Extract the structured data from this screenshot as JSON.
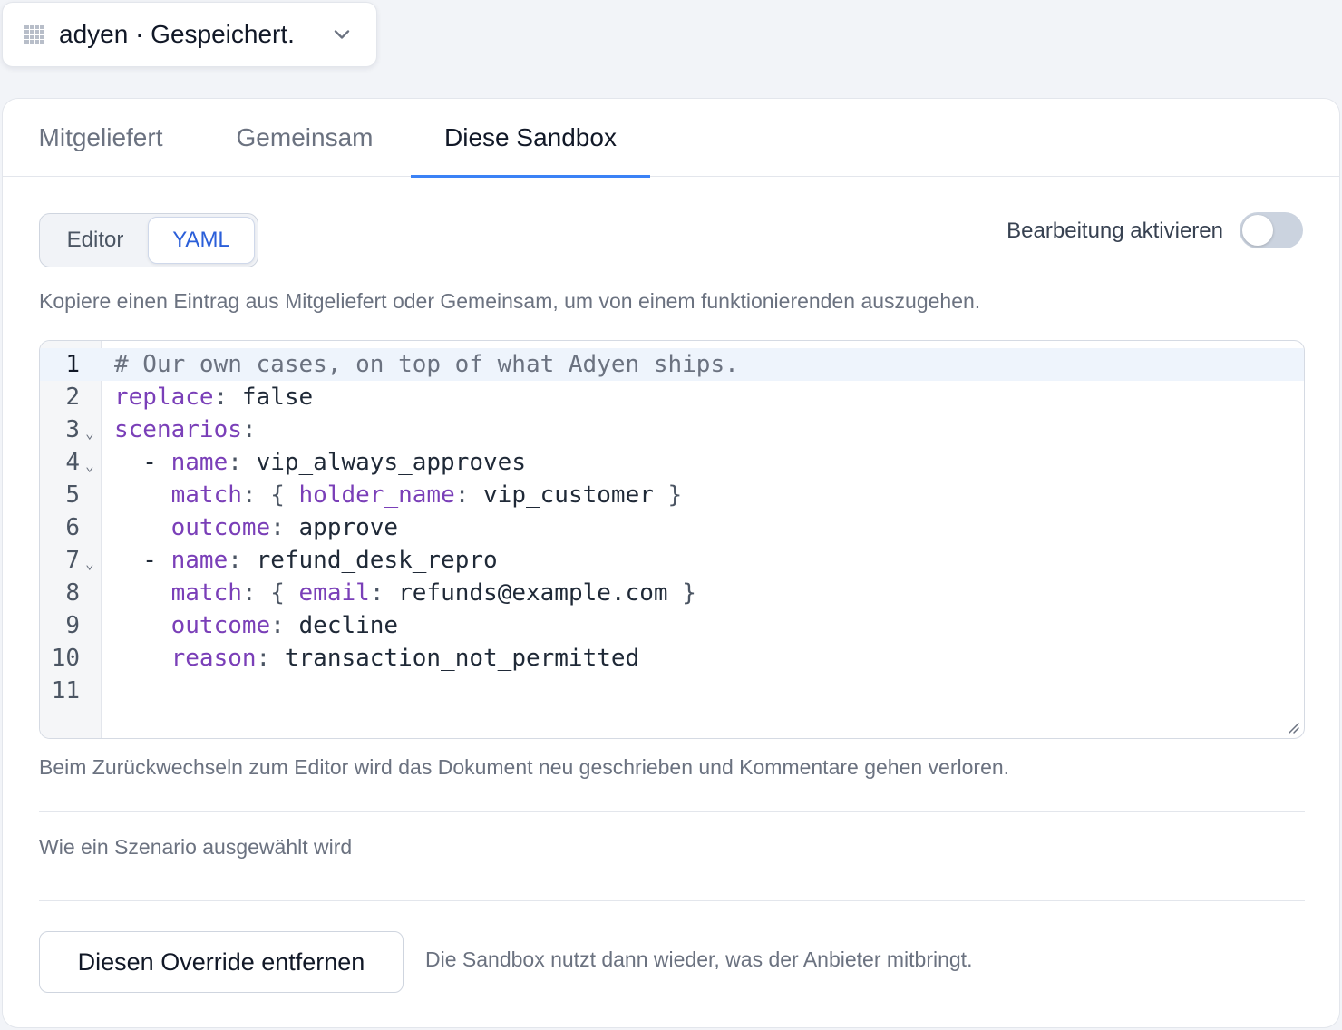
{
  "picker": {
    "label": "adyen · Gespeichert.",
    "icon": "grid-icon"
  },
  "tabs": [
    {
      "label": "Mitgeliefert",
      "active": false
    },
    {
      "label": "Gemeinsam",
      "active": false
    },
    {
      "label": "Diese Sandbox",
      "active": true
    }
  ],
  "mode_switch": {
    "editor_label": "Editor",
    "yaml_label": "YAML",
    "selected": "YAML"
  },
  "edit_toggle": {
    "label": "Bearbeitung aktivieren",
    "enabled": false
  },
  "hint_text": "Kopiere einen Eintrag aus Mitgeliefert oder Gemeinsam, um von einem funktionierenden auszugehen.",
  "code": {
    "lines": [
      {
        "n": "1",
        "fold": false,
        "tokens": [
          {
            "t": "c",
            "s": "# Our own cases, on top of what Adyen ships."
          }
        ]
      },
      {
        "n": "2",
        "fold": false,
        "tokens": [
          {
            "t": "k",
            "s": "replace"
          },
          {
            "t": "p",
            "s": ": "
          },
          {
            "t": "v",
            "s": "false"
          }
        ]
      },
      {
        "n": "3",
        "fold": true,
        "tokens": [
          {
            "t": "k",
            "s": "scenarios"
          },
          {
            "t": "p",
            "s": ":"
          }
        ]
      },
      {
        "n": "4",
        "fold": true,
        "tokens": [
          {
            "t": "v",
            "s": "  - "
          },
          {
            "t": "k",
            "s": "name"
          },
          {
            "t": "p",
            "s": ": "
          },
          {
            "t": "v",
            "s": "vip_always_approves"
          }
        ]
      },
      {
        "n": "5",
        "fold": false,
        "tokens": [
          {
            "t": "v",
            "s": "    "
          },
          {
            "t": "k",
            "s": "match"
          },
          {
            "t": "p",
            "s": ": { "
          },
          {
            "t": "k",
            "s": "holder_name"
          },
          {
            "t": "p",
            "s": ": "
          },
          {
            "t": "v",
            "s": "vip_customer"
          },
          {
            "t": "p",
            "s": " }"
          }
        ]
      },
      {
        "n": "6",
        "fold": false,
        "tokens": [
          {
            "t": "v",
            "s": "    "
          },
          {
            "t": "k",
            "s": "outcome"
          },
          {
            "t": "p",
            "s": ": "
          },
          {
            "t": "v",
            "s": "approve"
          }
        ]
      },
      {
        "n": "7",
        "fold": true,
        "tokens": [
          {
            "t": "v",
            "s": "  - "
          },
          {
            "t": "k",
            "s": "name"
          },
          {
            "t": "p",
            "s": ": "
          },
          {
            "t": "v",
            "s": "refund_desk_repro"
          }
        ]
      },
      {
        "n": "8",
        "fold": false,
        "tokens": [
          {
            "t": "v",
            "s": "    "
          },
          {
            "t": "k",
            "s": "match"
          },
          {
            "t": "p",
            "s": ": { "
          },
          {
            "t": "k",
            "s": "email"
          },
          {
            "t": "p",
            "s": ": "
          },
          {
            "t": "v",
            "s": "refunds@example.com"
          },
          {
            "t": "p",
            "s": " }"
          }
        ]
      },
      {
        "n": "9",
        "fold": false,
        "tokens": [
          {
            "t": "v",
            "s": "    "
          },
          {
            "t": "k",
            "s": "outcome"
          },
          {
            "t": "p",
            "s": ": "
          },
          {
            "t": "v",
            "s": "decline"
          }
        ]
      },
      {
        "n": "10",
        "fold": false,
        "tokens": [
          {
            "t": "v",
            "s": "    "
          },
          {
            "t": "k",
            "s": "reason"
          },
          {
            "t": "p",
            "s": ": "
          },
          {
            "t": "v",
            "s": "transaction_not_permitted"
          }
        ]
      },
      {
        "n": "11",
        "fold": false,
        "tokens": []
      }
    ],
    "active_line": "1"
  },
  "after_note": "Beim Zurückwechseln zum Editor wird das Dokument neu geschrieben und Kommentare gehen verloren.",
  "selection_section": {
    "title": "Wie ein Szenario ausgewählt wird"
  },
  "remove": {
    "button_label": "Diesen Override entfernen",
    "note": "Die Sandbox nutzt dann wieder, was der Anbieter mitbringt."
  },
  "colors": {
    "accent": "#3b82f6",
    "yaml_key": "#7a3fb8",
    "active_line_bg": "#eef4fc"
  }
}
